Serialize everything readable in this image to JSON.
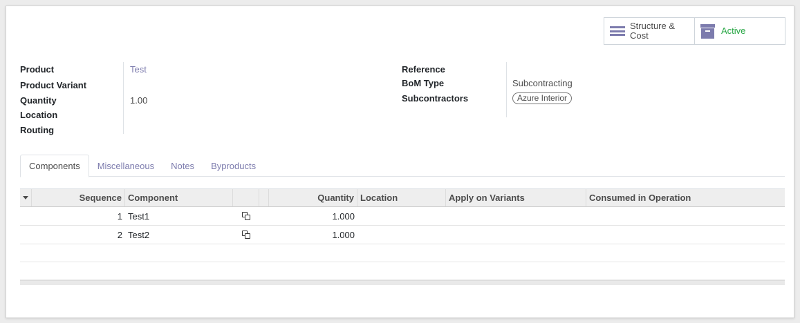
{
  "smart_buttons": {
    "structure_cost_line1": "Structure &",
    "structure_cost_line2": "Cost",
    "active_label": "Active",
    "icons": [
      "bars-icon",
      "archive-icon"
    ]
  },
  "left_group": {
    "product_label": "Product",
    "product_value": "Test",
    "product_variant_label": "Product Variant",
    "quantity_label": "Quantity",
    "quantity_value": "1.00",
    "location_label": "Location",
    "routing_label": "Routing"
  },
  "right_group": {
    "reference_label": "Reference",
    "bom_type_label": "BoM Type",
    "bom_type_value": "Subcontracting",
    "subcontractors_label": "Subcontractors",
    "subcontractor_tag": "Azure Interior"
  },
  "tabs": [
    {
      "label": "Components"
    },
    {
      "label": "Miscellaneous"
    },
    {
      "label": "Notes"
    },
    {
      "label": "Byproducts"
    }
  ],
  "table": {
    "headers": {
      "sequence": "Sequence",
      "component": "Component",
      "quantity": "Quantity",
      "location": "Location",
      "apply_on_variants": "Apply on Variants",
      "consumed_in_operation": "Consumed in Operation"
    },
    "rows": [
      {
        "sequence": "1",
        "component": "Test1",
        "quantity": "1.000"
      },
      {
        "sequence": "2",
        "component": "Test2",
        "quantity": "1.000"
      }
    ]
  },
  "colors": {
    "link": "#7c7bad",
    "active_green": "#28a745"
  }
}
